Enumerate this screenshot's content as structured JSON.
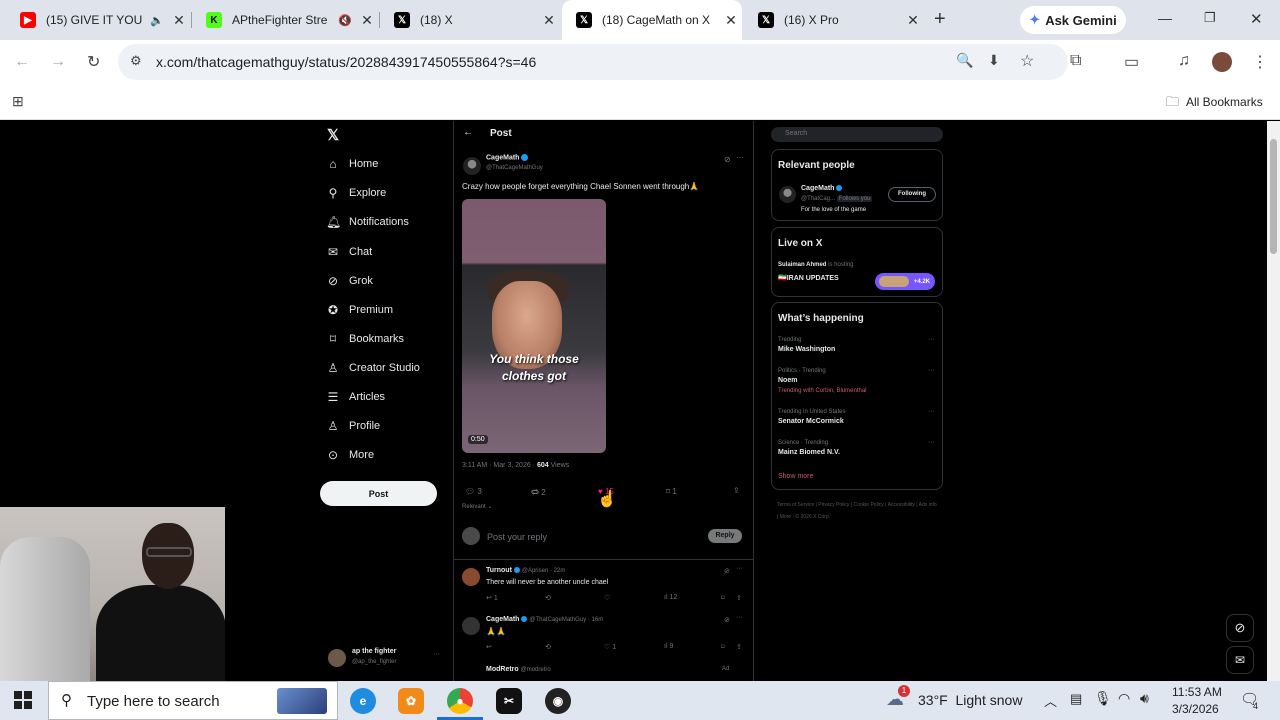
{
  "browser": {
    "tabs": [
      {
        "title": "(15) GIVE IT YOU",
        "favicon": "youtube-icon",
        "muted": true
      },
      {
        "title": "APtheFighter Stre",
        "favicon": "kick-icon",
        "muted": true
      },
      {
        "title": "(18) X",
        "favicon": "x-icon"
      },
      {
        "title": "(18) CageMath on X",
        "favicon": "x-icon",
        "active": true
      },
      {
        "title": "(16) X Pro",
        "favicon": "x-icon"
      }
    ],
    "new_tab": "+",
    "gemini": "Ask Gemini",
    "url": "x.com/thatcagemathguy/status/2028843917450555864?s=46",
    "all_bookmarks": "All Bookmarks"
  },
  "x": {
    "nav": [
      {
        "label": "Home",
        "icon": "home-icon"
      },
      {
        "label": "Explore",
        "icon": "search-icon"
      },
      {
        "label": "Notifications",
        "icon": "bell-icon"
      },
      {
        "label": "Chat",
        "icon": "mail-icon"
      },
      {
        "label": "Grok",
        "icon": "grok-icon"
      },
      {
        "label": "Premium",
        "icon": "premium-icon"
      },
      {
        "label": "Bookmarks",
        "icon": "bookmark-icon"
      },
      {
        "label": "Creator Studio",
        "icon": "creator-icon"
      },
      {
        "label": "Articles",
        "icon": "articles-icon"
      },
      {
        "label": "Profile",
        "icon": "person-icon"
      },
      {
        "label": "More",
        "icon": "more-icon"
      }
    ],
    "post_button": "Post",
    "account": {
      "name": "ap the fighter",
      "handle": "@ap_the_fighter"
    },
    "header_title": "Post",
    "post": {
      "author": "CageMath",
      "handle": "@ThatCageMathGuy",
      "text": "Crazy how people forget everything Chael Sonnen went through🙏",
      "video_caption_line1": "You think those",
      "video_caption_line2": "clothes got",
      "video_duration": "0:50",
      "time": "3:11 AM · Mar 3, 2026 ·",
      "views_count": "604",
      "views_label": "Views",
      "replies": "3",
      "reposts": "2",
      "likes": "15",
      "bookmarks": "1",
      "sort": "Relevant"
    },
    "reply_placeholder": "Post your reply",
    "reply_button": "Reply",
    "replies": [
      {
        "name": "Turnout",
        "handle": "@Aprisen · 22m",
        "text": "There will never be another uncle chael",
        "replies": "1",
        "likes": "",
        "views": "12"
      },
      {
        "name": "CageMath",
        "handle": "@ThatCageMathGuy · 16m",
        "text": "🙏🙏",
        "replies": "",
        "likes": "1",
        "views": "9"
      },
      {
        "name": "ModRetro",
        "handle": "@modretro",
        "text": "",
        "ad": "Ad"
      }
    ],
    "search_placeholder": "Search",
    "relevant_people": {
      "title": "Relevant people",
      "name": "CageMath",
      "handle": "@ThatCag...",
      "follows_you": "Follows you",
      "bio": "For the love of the game",
      "button": "Following"
    },
    "live": {
      "title": "Live on X",
      "host": "Sulaiman Ahmed",
      "host_suffix": "is hosting",
      "topic": "🇮🇷IRAN UPDATES",
      "listeners": "+4.2K"
    },
    "happening": {
      "title": "What’s happening",
      "trends": [
        {
          "meta": "Trending",
          "name": "Mike Washington",
          "sub": ""
        },
        {
          "meta": "Politics · Trending",
          "name": "Noem",
          "sub": "Trending with Corbin, Blumenthal"
        },
        {
          "meta": "Trending in United States",
          "name": "Senator McCormick",
          "sub": ""
        },
        {
          "meta": "Science · Trending",
          "name": "Mainz Biomed N.V.",
          "sub": ""
        }
      ],
      "show_more": "Show more"
    },
    "footer_links": "Terms of Service | Privacy Policy | Cookie Policy | Accessibility | Ads info | More · © 2026 X Corp."
  },
  "taskbar": {
    "search_placeholder": "Type here to search",
    "weather": "33°F  Light snow",
    "time": "11:53 AM",
    "date": "3/3/2026",
    "notif_count": "1",
    "action_count": "4"
  },
  "colors": {
    "accent": "#1d9bf0",
    "like": "#f91880",
    "x_bg": "#000000",
    "chrome_tabbar": "#dfe3eb"
  }
}
